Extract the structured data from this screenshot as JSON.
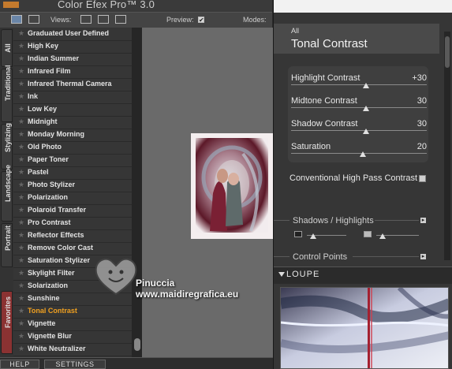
{
  "app": {
    "title": "Color Efex Pro™ 3.0"
  },
  "toolbar": {
    "views_label": "Views:",
    "preview_label": "Preview:",
    "preview_checked": "✔",
    "modes_label": "Modes:"
  },
  "tabs": [
    "All",
    "Traditional",
    "Stylizing",
    "Landscape",
    "Portrait",
    "Favorites"
  ],
  "filters": [
    "Graduated User Defined",
    "High Key",
    "Indian Summer",
    "Infrared Film",
    "Infrared Thermal Camera",
    "Ink",
    "Low Key",
    "Midnight",
    "Monday Morning",
    "Old Photo",
    "Paper Toner",
    "Pastel",
    "Photo Stylizer",
    "Polarization",
    "Polaroid Transfer",
    "Pro Contrast",
    "Reflector Effects",
    "Remove Color Cast",
    "Saturation Stylizer",
    "Skylight Filter",
    "Solarization",
    "Sunshine",
    "Tonal Contrast",
    "Vignette",
    "Vignette Blur",
    "White Neutralizer"
  ],
  "selected_filter": "Tonal Contrast",
  "list_scroll_fraction": 0.97,
  "panel": {
    "category": "All",
    "filter_name": "Tonal Contrast",
    "sliders": [
      {
        "label": "Highlight Contrast",
        "value": "+30",
        "position": 0.55
      },
      {
        "label": "Midtone Contrast",
        "value": "30",
        "position": 0.55
      },
      {
        "label": "Shadow Contrast",
        "value": "30",
        "position": 0.55
      },
      {
        "label": "Saturation",
        "value": "20",
        "position": 0.53
      }
    ],
    "checkbox_label": "Conventional High Pass Contrast",
    "shadows_highlights_label": "Shadows / Highlights",
    "control_points_label": "Control Points",
    "loupe_label": "LOUPE"
  },
  "bottom": {
    "help": "HELP",
    "settings": "SETTINGS"
  },
  "watermark": {
    "line1": "Pinuccia",
    "line2": "www.maidiregrafica.eu"
  },
  "colors": {
    "accent": "#f0a020",
    "favorites_tab": "#8b3232"
  }
}
